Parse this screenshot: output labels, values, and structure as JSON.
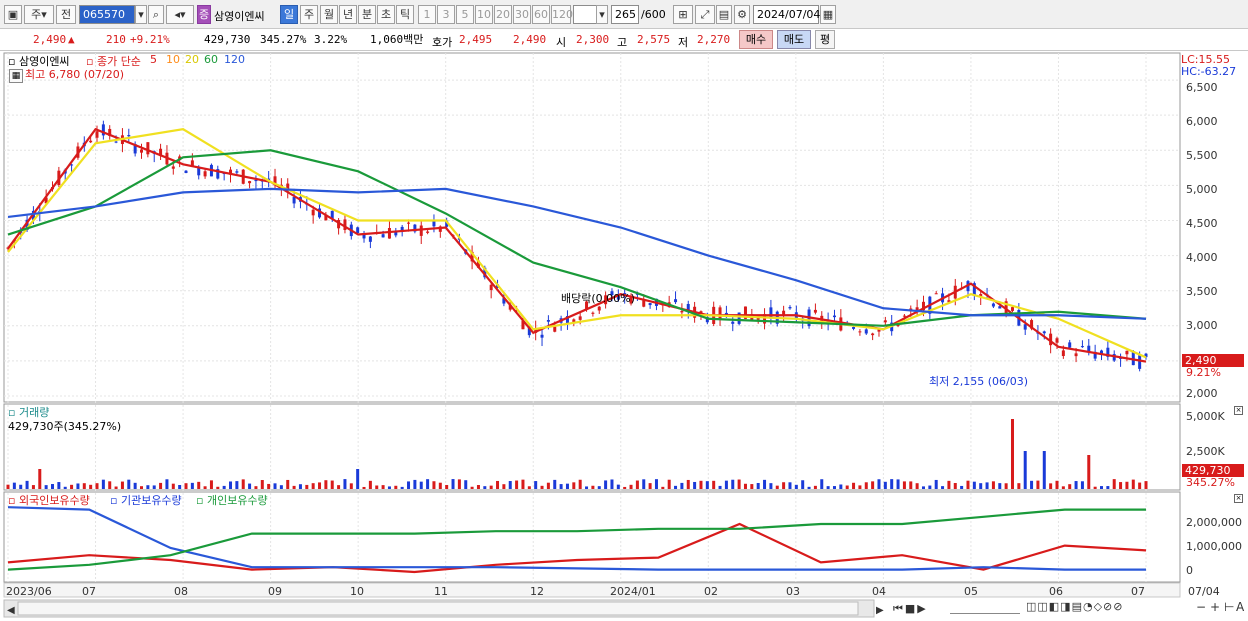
{
  "toolbar": {
    "period_buttons": [
      "주",
      "전"
    ],
    "code": "065570",
    "stock_badge": "증",
    "stock_name": "삼영이엔씨",
    "interval_tabs": [
      "일",
      "주",
      "월",
      "년",
      "분",
      "초",
      "틱"
    ],
    "interval_selected": "일",
    "multipliers": [
      "1",
      "3",
      "5",
      "10",
      "20",
      "30",
      "60",
      "120"
    ],
    "count": "265",
    "count_total": "/600",
    "date": "2024/07/04"
  },
  "info": {
    "price": "2,490",
    "change_arrow": "▲",
    "change": "210",
    "change_pct": "+9.21%",
    "volume": "429,730",
    "volume_ratio": "345.27%",
    "turnover_pct": "3.22%",
    "amount": "1,060백만",
    "ask_label": "호가",
    "ask": "2,495",
    "bid": "2,490",
    "open_label": "시",
    "open": "2,300",
    "high_label": "고",
    "high": "2,575",
    "low_label": "저",
    "low": "2,270",
    "buy_label": "매수",
    "sell_label": "매도",
    "avg_label": "평"
  },
  "price_panel": {
    "title": "삼영이엔씨",
    "ma_label": "종가 단순",
    "ma_periods": [
      "5",
      "10",
      "20",
      "60",
      "120"
    ],
    "lc": "LC:15.55",
    "hc": "HC:-63.27",
    "y_ticks": [
      "6,500",
      "6,000",
      "5,500",
      "5,000",
      "4,500",
      "4,000",
      "3,500",
      "3,000",
      "2,500",
      "2,000"
    ],
    "high_note": "최고 6,780 (07/20)",
    "low_note": "최저 2,155 (06/03)",
    "dividend_note": "배당락(0.00%)",
    "last_price_tag": "2,490",
    "last_pct_tag": "9.21%"
  },
  "volume_panel": {
    "title": "거래량",
    "summary": "429,730주(345.27%)",
    "y_ticks": [
      "5,000K",
      "2,500K"
    ],
    "last_tag": "429,730",
    "last_pct_tag": "345.27%"
  },
  "holdings_panel": {
    "series": [
      "외국인보유수량",
      "기관보유수량",
      "개인보유수량"
    ],
    "y_ticks": [
      "2,000,000",
      "1,000,000",
      "0"
    ]
  },
  "x_axis": [
    "2023/06",
    "07",
    "08",
    "09",
    "10",
    "11",
    "12",
    "2024/01",
    "02",
    "03",
    "04",
    "05",
    "06",
    "06",
    "07",
    "07/04"
  ],
  "colors": {
    "ma5": "#d81b1b",
    "ma10": "#ff8c1a",
    "ma20": "#f0e020",
    "ma60": "#1a9a3a",
    "ma120": "#2a58d8",
    "up": "#d81b1b",
    "down": "#1a3ad8"
  },
  "chart_data": {
    "type": "line",
    "title": "삼영이엔씨",
    "x": [
      "2023-06",
      "2023-07",
      "2023-08",
      "2023-09",
      "2023-10",
      "2023-11",
      "2023-12",
      "2024-01",
      "2024-02",
      "2024-03",
      "2024-04",
      "2024-05",
      "2024-06",
      "2024-07"
    ],
    "ylim": [
      2000,
      6800
    ],
    "series": [
      {
        "name": "5",
        "values": [
          4100,
          5800,
          5300,
          5050,
          4300,
          4400,
          2900,
          3450,
          3150,
          3150,
          2950,
          3600,
          2700,
          2490
        ]
      },
      {
        "name": "20",
        "values": [
          4050,
          5600,
          5800,
          5050,
          4500,
          4500,
          2950,
          3150,
          3150,
          3100,
          2950,
          3450,
          3100,
          2550
        ]
      },
      {
        "name": "60",
        "values": [
          4300,
          4700,
          5400,
          5500,
          5200,
          4600,
          3900,
          3550,
          3100,
          3050,
          3000,
          3150,
          3200,
          3100
        ]
      },
      {
        "name": "120",
        "values": [
          4550,
          4700,
          4900,
          4950,
          4900,
          4950,
          4700,
          4400,
          4000,
          3650,
          3250,
          3150,
          3150,
          3100
        ]
      }
    ],
    "annotations": [
      "최고 6,780 (07/20)",
      "최저 2,155 (06/03)",
      "배당락(0.00%)"
    ]
  }
}
